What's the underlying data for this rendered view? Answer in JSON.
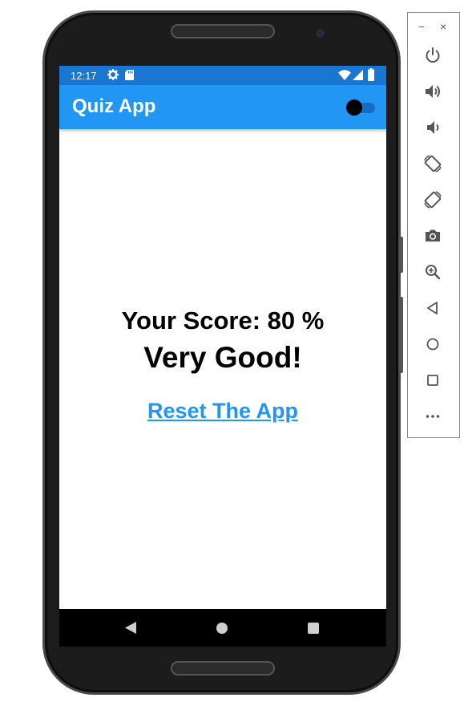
{
  "status_bar": {
    "time": "12:17"
  },
  "app_bar": {
    "title": "Quiz App"
  },
  "result": {
    "score_text": "Your Score: 80 %",
    "verdict_text": "Very Good!",
    "reset_label": "Reset The App"
  },
  "theme_toggle": {
    "state": "off"
  },
  "emulator_toolbar": {
    "minimize_glyph": "−",
    "close_glyph": "×",
    "buttons": [
      "power-icon",
      "volume-up-icon",
      "volume-down-icon",
      "rotate-left-icon",
      "rotate-right-icon",
      "camera-icon",
      "zoom-icon",
      "back-icon",
      "home-icon",
      "overview-icon",
      "more-icon"
    ]
  },
  "colors": {
    "status_bar": "#1976d2",
    "app_bar": "#2196f3",
    "link": "#2196f3",
    "nav_bar": "#000000",
    "toolbar_icon": "#555555"
  }
}
